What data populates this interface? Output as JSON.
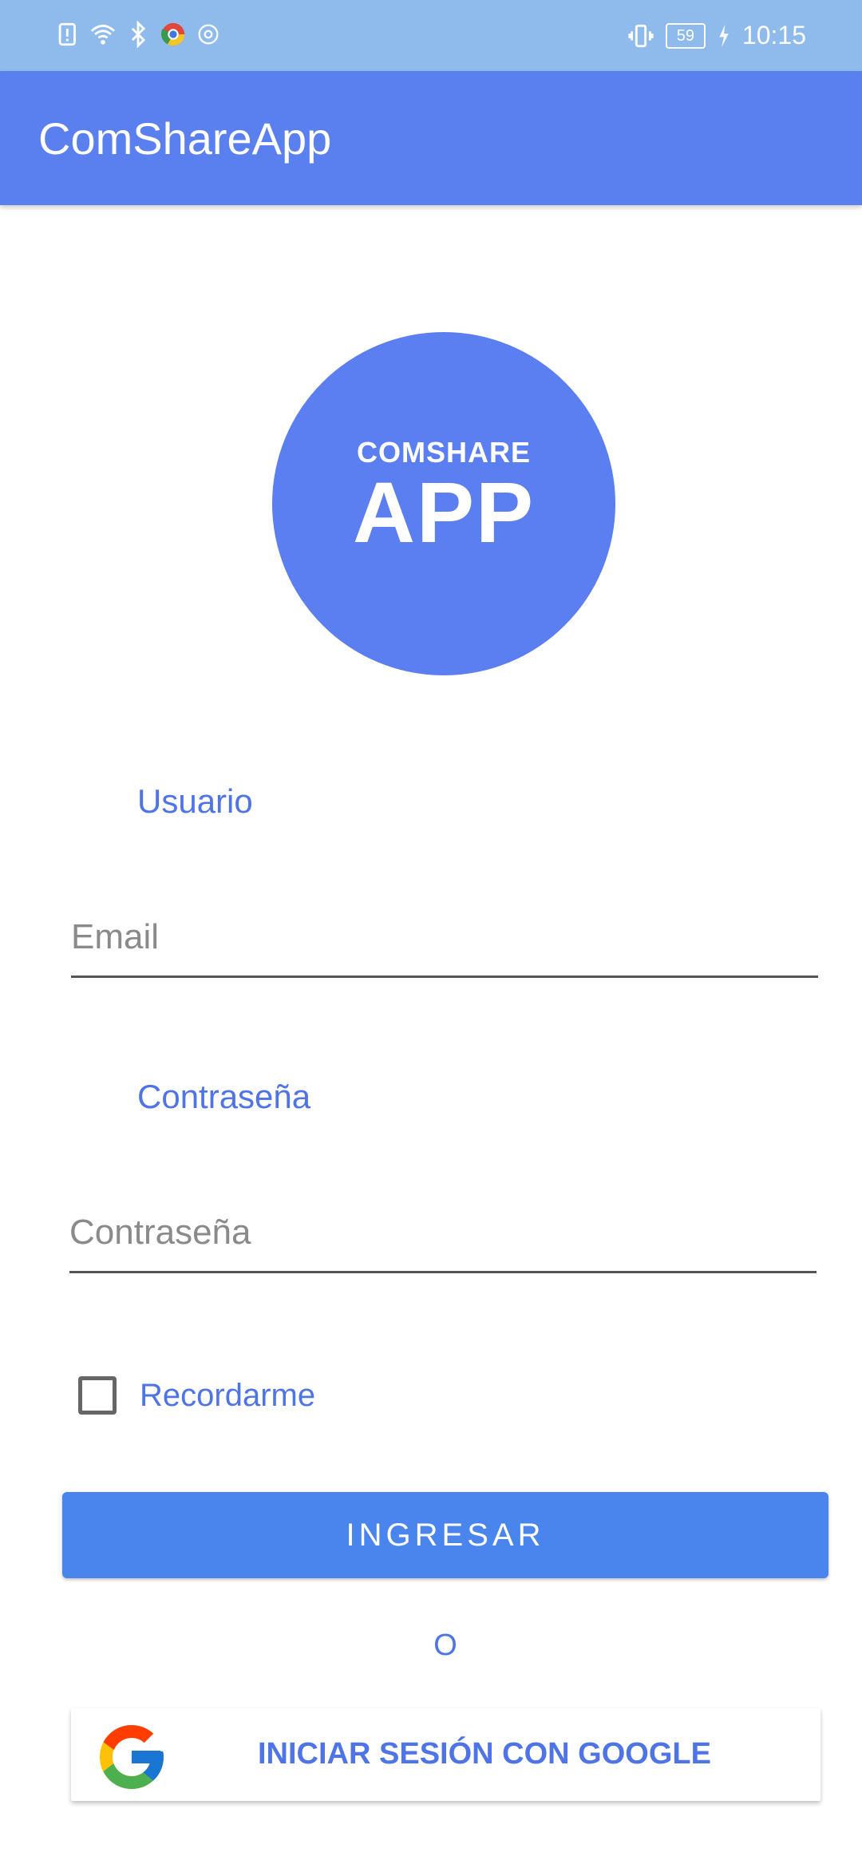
{
  "status_bar": {
    "time": "10:15",
    "battery": "59",
    "icons": [
      "sim-alert-icon",
      "wifi-icon",
      "bluetooth-icon",
      "chrome-icon",
      "at-icon",
      "vibrate-icon",
      "battery-icon",
      "charging-icon"
    ]
  },
  "appbar": {
    "title": "ComShareApp"
  },
  "logo": {
    "line1": "COMSHARE",
    "line2": "APP"
  },
  "form": {
    "user_label": "Usuario",
    "email_placeholder": "Email",
    "password_label": "Contraseña",
    "password_placeholder": "Contraseña",
    "remember_label": "Recordarme",
    "remember_checked": false,
    "submit_label": "INGRESAR",
    "or_text": "O",
    "google_label": "INICIAR SESIÓN CON GOOGLE"
  },
  "colors": {
    "status_bar": "#8ebbec",
    "appbar": "#5a80f0",
    "accent": "#4e74e6",
    "button": "#4a85ee"
  }
}
